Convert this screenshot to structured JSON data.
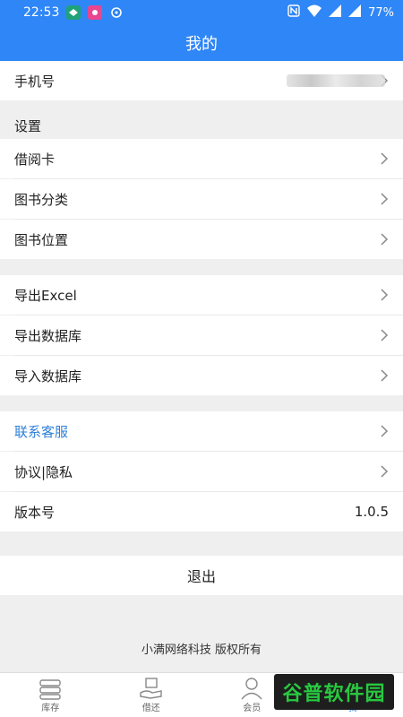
{
  "status_bar": {
    "time": "22:53",
    "battery": "77%"
  },
  "header": {
    "title": "我的"
  },
  "phone_row": {
    "label": "手机号"
  },
  "settings": {
    "title": "设置",
    "items": [
      {
        "label": "借阅卡"
      },
      {
        "label": "图书分类"
      },
      {
        "label": "图书位置"
      }
    ]
  },
  "data_section": {
    "items": [
      {
        "label": "导出Excel"
      },
      {
        "label": "导出数据库"
      },
      {
        "label": "导入数据库"
      }
    ]
  },
  "about_section": {
    "items": [
      {
        "label": "联系客服"
      },
      {
        "label": "协议|隐私"
      }
    ],
    "version_label": "版本号",
    "version_value": "1.0.5"
  },
  "logout_label": "退出",
  "copyright": "小满网络科技 版权所有",
  "tabs": [
    {
      "label": "库存",
      "icon": "books-icon"
    },
    {
      "label": "借还",
      "icon": "hand-book-icon"
    },
    {
      "label": "会员",
      "icon": "member-icon"
    },
    {
      "label": "我",
      "icon": "me-icon"
    }
  ],
  "watermark": "谷普软件园",
  "colors": {
    "primary": "#2f86f6",
    "link": "#2e7fd8",
    "background": "#efefef"
  }
}
